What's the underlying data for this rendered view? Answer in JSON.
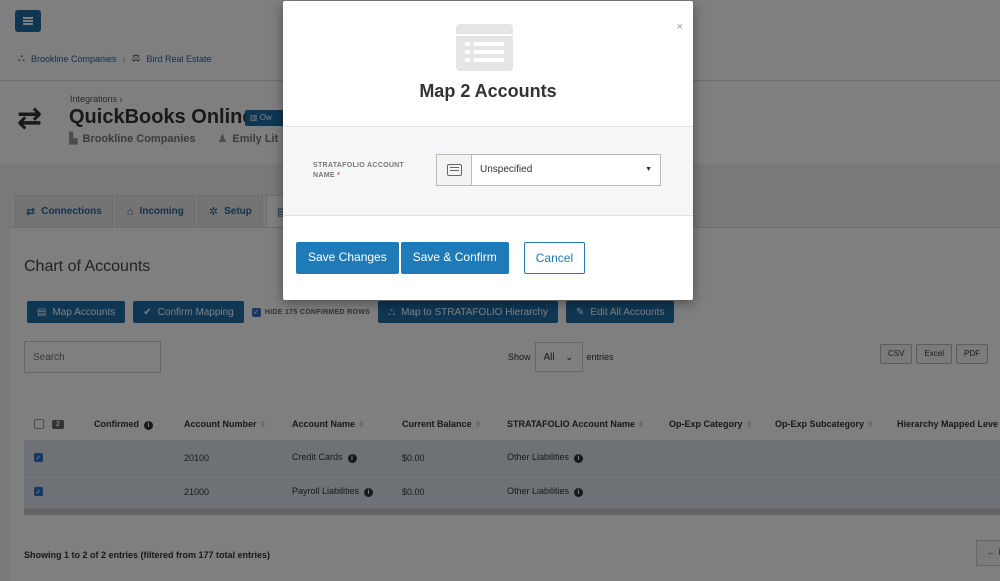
{
  "breadcrumb": [
    "Brookline Companies",
    "Bird Real Estate"
  ],
  "header": {
    "parent": "Integrations",
    "parent_sep": "›",
    "title": "QuickBooks Online",
    "badge": "Ow",
    "company": "Brookline Companies",
    "user": "Emily Lit"
  },
  "tabs": [
    {
      "label": "Connections"
    },
    {
      "label": "Incoming"
    },
    {
      "label": "Setup"
    }
  ],
  "panel": {
    "title": "Chart of Accounts",
    "buttons": {
      "map_accounts": "Map Accounts",
      "confirm_mapping": "Confirm Mapping",
      "hide_rows": "HIDE 175 CONFIRMED ROWS",
      "map_hierarchy": "Map to STRATAFOLIO Hierarchy",
      "edit_all": "Edit All Accounts"
    },
    "search_placeholder": "Search",
    "show_label": "Show",
    "show_value": "All",
    "entries_label": "entries",
    "exports": [
      "CSV",
      "Excel",
      "PDF"
    ],
    "selected_count": "2"
  },
  "table": {
    "columns": [
      "Confirmed",
      "Account Number",
      "Account Name",
      "Current Balance",
      "STRATAFOLIO Account Name",
      "Op-Exp Category",
      "Op-Exp Subcategory",
      "Hierarchy Mapped Leve"
    ],
    "rows": [
      {
        "number": "20100",
        "name": "Credit Cards",
        "balance": "$0.00",
        "stratafolio": "Other Liabilities"
      },
      {
        "number": "21000",
        "name": "Payroll Liabilities",
        "balance": "$0.00",
        "stratafolio": "Other Liabilities"
      }
    ]
  },
  "footer": {
    "summary": "Showing 1 to 2 of 2 entries (filtered from 177 total entries)",
    "prev": "← P"
  },
  "modal": {
    "title": "Map 2 Accounts",
    "close": "×",
    "field_label": "STRATAFOLIO ACCOUNT NAME",
    "required_mark": "*",
    "select_value": "Unspecified",
    "save_changes": "Save Changes",
    "save_confirm": "Save & Confirm",
    "cancel": "Cancel"
  },
  "colors": {
    "primary": "#1f6ea8",
    "row_highlight": "#dde3ea",
    "overlay": "rgba(0,0,0,0.5)"
  }
}
